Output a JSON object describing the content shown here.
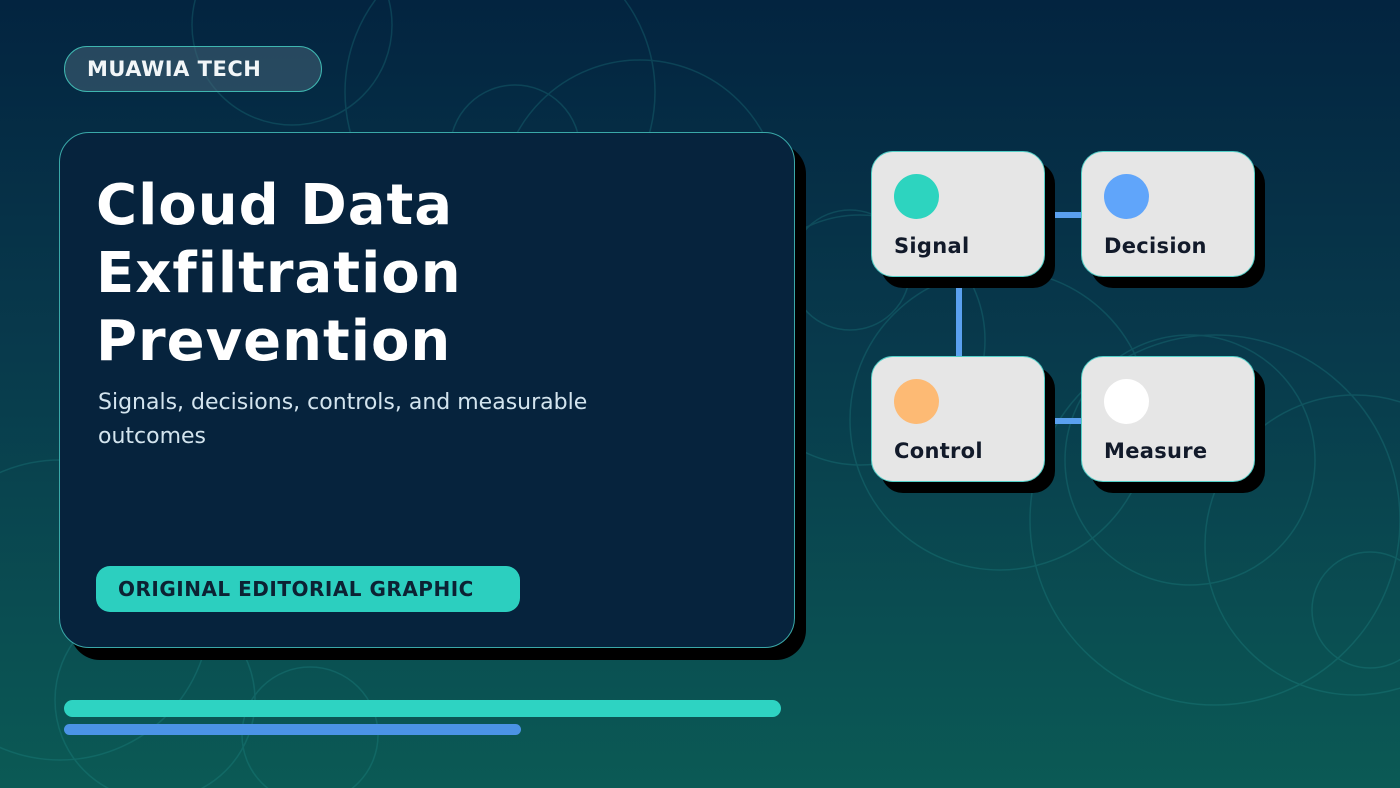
{
  "brand": {
    "label": "MUAWIA TECH"
  },
  "hero": {
    "title_lines": [
      "Cloud Data",
      "Exfiltration",
      "Prevention"
    ],
    "subtitle": "Signals, decisions, controls, and measurable outcomes",
    "tag": "ORIGINAL EDITORIAL GRAPHIC"
  },
  "diagram": {
    "nodes": [
      {
        "label": "Signal",
        "dot_color": "#2dd4bf"
      },
      {
        "label": "Decision",
        "dot_color": "#60a5fa"
      },
      {
        "label": "Control",
        "dot_color": "#fdba74"
      },
      {
        "label": "Measure",
        "dot_color": "#ffffff"
      }
    ],
    "connector_color": "#5aa0ef"
  },
  "colors": {
    "accent_teal": "#2ed3c2",
    "accent_blue": "#4b93e6",
    "card_bg": "#06233d"
  }
}
